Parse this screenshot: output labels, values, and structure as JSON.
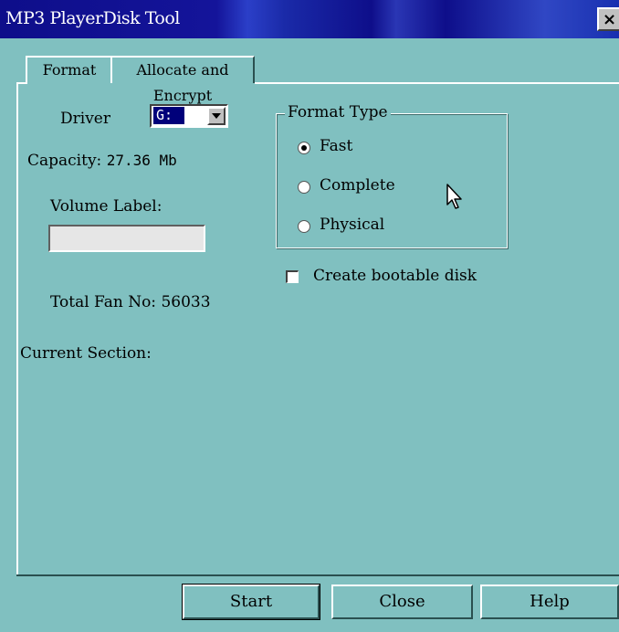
{
  "window": {
    "title": "MP3 PlayerDisk Tool",
    "close_label": "×"
  },
  "tabs": [
    {
      "label": "Format",
      "active": true
    },
    {
      "label": "Allocate and Encrypt",
      "active": false
    }
  ],
  "format": {
    "driver_label": "Driver",
    "driver_value": "G:",
    "capacity_label": "Capacity:",
    "capacity_value": "27.36 Mb",
    "volume_label_label": "Volume Label:",
    "volume_label_value": "",
    "total_fan_label": "Total Fan No:",
    "total_fan_value": "56033",
    "current_section_label": "Current Section:",
    "current_section_value": ""
  },
  "format_type": {
    "legend": "Format Type",
    "options": [
      {
        "label": "Fast",
        "checked": true
      },
      {
        "label": "Complete",
        "checked": false
      },
      {
        "label": "Physical",
        "checked": false
      }
    ]
  },
  "bootable": {
    "label": "Create bootable disk",
    "checked": false
  },
  "buttons": {
    "start": "Start",
    "close": "Close",
    "help": "Help"
  },
  "colors": {
    "window_bg": "#80c0c0",
    "title_bg": "#0e0e8a",
    "selection": "#00007a"
  },
  "icons": {
    "cursor": "mouse-pointer-icon",
    "dropdown": "chevron-down-icon",
    "close": "close-icon"
  }
}
